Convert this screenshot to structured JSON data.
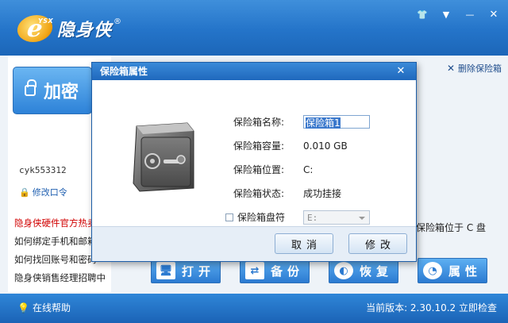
{
  "app": {
    "logo_letter": "e",
    "logo_tag": "YSX",
    "logo_title": "隐身侠",
    "registered": "®"
  },
  "window_controls": {
    "skin": "👕",
    "menu": "▼",
    "minimize": "—",
    "close": "✕"
  },
  "left_panel": {
    "encrypt_label": "加密",
    "username": "cyk553312",
    "change_password": "修改口令",
    "news": [
      "隐身侠硬件官方热卖",
      "如何绑定手机和邮箱",
      "如何找回账号和密码",
      "隐身侠销售经理招聘中"
    ]
  },
  "right_panel": {
    "delete_safe": "删除保险箱",
    "safe_location_note": "保险箱位于 C 盘"
  },
  "actions": [
    {
      "label": "打开",
      "icon": "monitor-icon"
    },
    {
      "label": "备份",
      "icon": "arrows-icon"
    },
    {
      "label": "恢复",
      "icon": "circle-icon"
    },
    {
      "label": "属性",
      "icon": "pie-icon"
    }
  ],
  "statusbar": {
    "help": "在线帮助",
    "version": "当前版本: 2.30.10.2 立即检查"
  },
  "dialog": {
    "title": "保险箱属性",
    "close": "✕",
    "properties": {
      "name_label": "保险箱名称:",
      "name_value": "保险箱1",
      "capacity_label": "保险箱容量:",
      "capacity_value": "0.010 GB",
      "location_label": "保险箱位置:",
      "location_value": "C:",
      "status_label": "保险箱状态:",
      "status_value": "成功挂接",
      "drive_label": "保险箱盘符",
      "drive_value": "E:"
    },
    "cancel": "取消",
    "modify": "修改"
  },
  "colors": {
    "title_blue": "#2474c9",
    "accent": "#2b7ad1",
    "hot_news": "#d10000"
  }
}
